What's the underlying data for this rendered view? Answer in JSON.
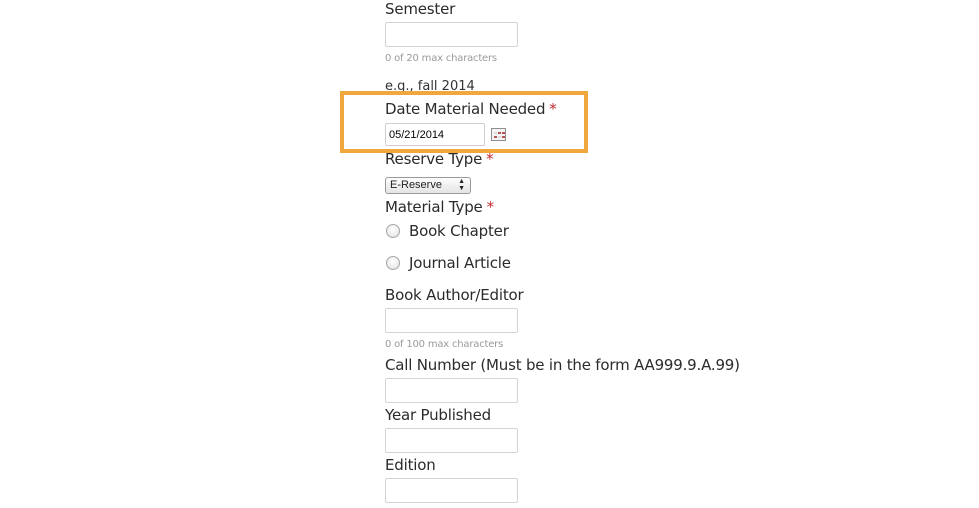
{
  "form": {
    "semester": {
      "label": "Semester",
      "value": "",
      "counter": "0 of 20 max characters",
      "example": "e.g., fall 2014"
    },
    "date_needed": {
      "label": "Date Material Needed",
      "required_mark": "*",
      "value": "05/21/2014"
    },
    "reserve_type": {
      "label": "Reserve Type",
      "required_mark": "*",
      "selected": "E-Reserve"
    },
    "material_type": {
      "label": "Material Type",
      "required_mark": "*",
      "options": [
        "Book Chapter",
        "Journal Article"
      ]
    },
    "book_author": {
      "label": "Book Author/Editor",
      "value": "",
      "counter": "0 of 100 max characters"
    },
    "call_number": {
      "label": "Call Number (Must be in the form AA999.9.A.99)",
      "value": ""
    },
    "year_published": {
      "label": "Year Published",
      "value": ""
    },
    "edition": {
      "label": "Edition",
      "value": ""
    }
  },
  "icons": {
    "calendar": "calendar-icon",
    "select_arrows": "up-down-arrows-icon"
  },
  "colors": {
    "required": "#c0282f",
    "highlight": "#f0a83c"
  }
}
